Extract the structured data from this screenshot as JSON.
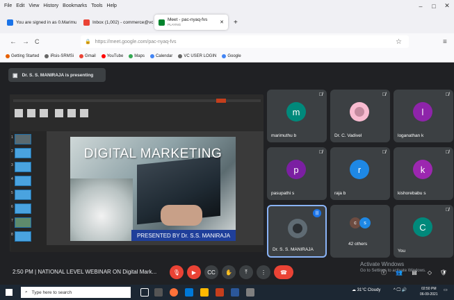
{
  "menu": [
    "File",
    "Edit",
    "View",
    "History",
    "Bookmarks",
    "Tools",
    "Help"
  ],
  "window_controls": [
    "–",
    "□",
    "✕"
  ],
  "tabs": [
    {
      "label": "You are signed in as 0.Marimuth ✕",
      "favicon_color": "#1a73e8"
    },
    {
      "label": "Inbox (1,002) - commerce@vcew ✕",
      "favicon_color": "#ea4335"
    },
    {
      "label": "Meet - pac-nyaq-fvs",
      "sub": "PLAYING",
      "favicon_color": "#00832d"
    }
  ],
  "new_tab": "+",
  "url": "https://meet.google.com/pac-nyaq-fvs",
  "nav": {
    "back": "←",
    "forward": "→",
    "reload": "C",
    "star": "☆",
    "menu": "≡"
  },
  "bookmarks": [
    {
      "label": "Getting Started",
      "color": "#e66000"
    },
    {
      "label": "iRsis-SRMSi",
      "color": "#666"
    },
    {
      "label": "Gmail",
      "color": "#ea4335"
    },
    {
      "label": "YouTube",
      "color": "#ff0000"
    },
    {
      "label": "Maps",
      "color": "#34a853"
    },
    {
      "label": "Calendar",
      "color": "#4285f4"
    },
    {
      "label": "VC USER LOGIN",
      "color": "#666"
    },
    {
      "label": "Google",
      "color": "#4285f4"
    }
  ],
  "presenting": "Dr. S. S. MANIRAJA is presenting",
  "slide": {
    "title": "DIGITAL MARKETING",
    "subtitle": "PRESENTED BY Dr. S.S. MANIRAJA",
    "thumb_numbers": [
      "1",
      "2",
      "3",
      "4",
      "5",
      "6",
      "7",
      "8"
    ]
  },
  "participants": [
    {
      "name": "marimuthu b",
      "initial": "m",
      "color": "#00897b",
      "muted": true
    },
    {
      "name": "Dr. C. Vadivel",
      "initial": "",
      "color": "#f48fb1",
      "muted": true
    },
    {
      "name": "loganathan k",
      "initial": "l",
      "color": "#8e24aa",
      "muted": true
    },
    {
      "name": "pasupathi s",
      "initial": "p",
      "color": "#7b1fa2",
      "muted": true
    },
    {
      "name": "raja b",
      "initial": "r",
      "color": "#1e88e5",
      "muted": true
    },
    {
      "name": "kishorebabu s",
      "initial": "k",
      "color": "#9c27b0",
      "muted": true
    },
    {
      "name": "Dr. S. S. MANIRAJA",
      "initial": "",
      "color": "#1a73e8",
      "muted": false
    },
    {
      "name": "42 others",
      "initial": "cs",
      "color": "#6d4c41",
      "muted": false
    },
    {
      "name": "You",
      "initial": "C",
      "color": "#00897b",
      "muted": true
    }
  ],
  "meeting_info": "2:50 PM  |  NATIONAL LEVEL WEBINAR ON Digital Mark...",
  "activate": {
    "line1": "Activate Windows",
    "line2": "Go to Settings to activate Windows."
  },
  "taskbar": {
    "search_placeholder": "Type here to search",
    "weather": "31°C  Cloudy",
    "time": "02:50 PM",
    "date": "06-09-2021"
  }
}
